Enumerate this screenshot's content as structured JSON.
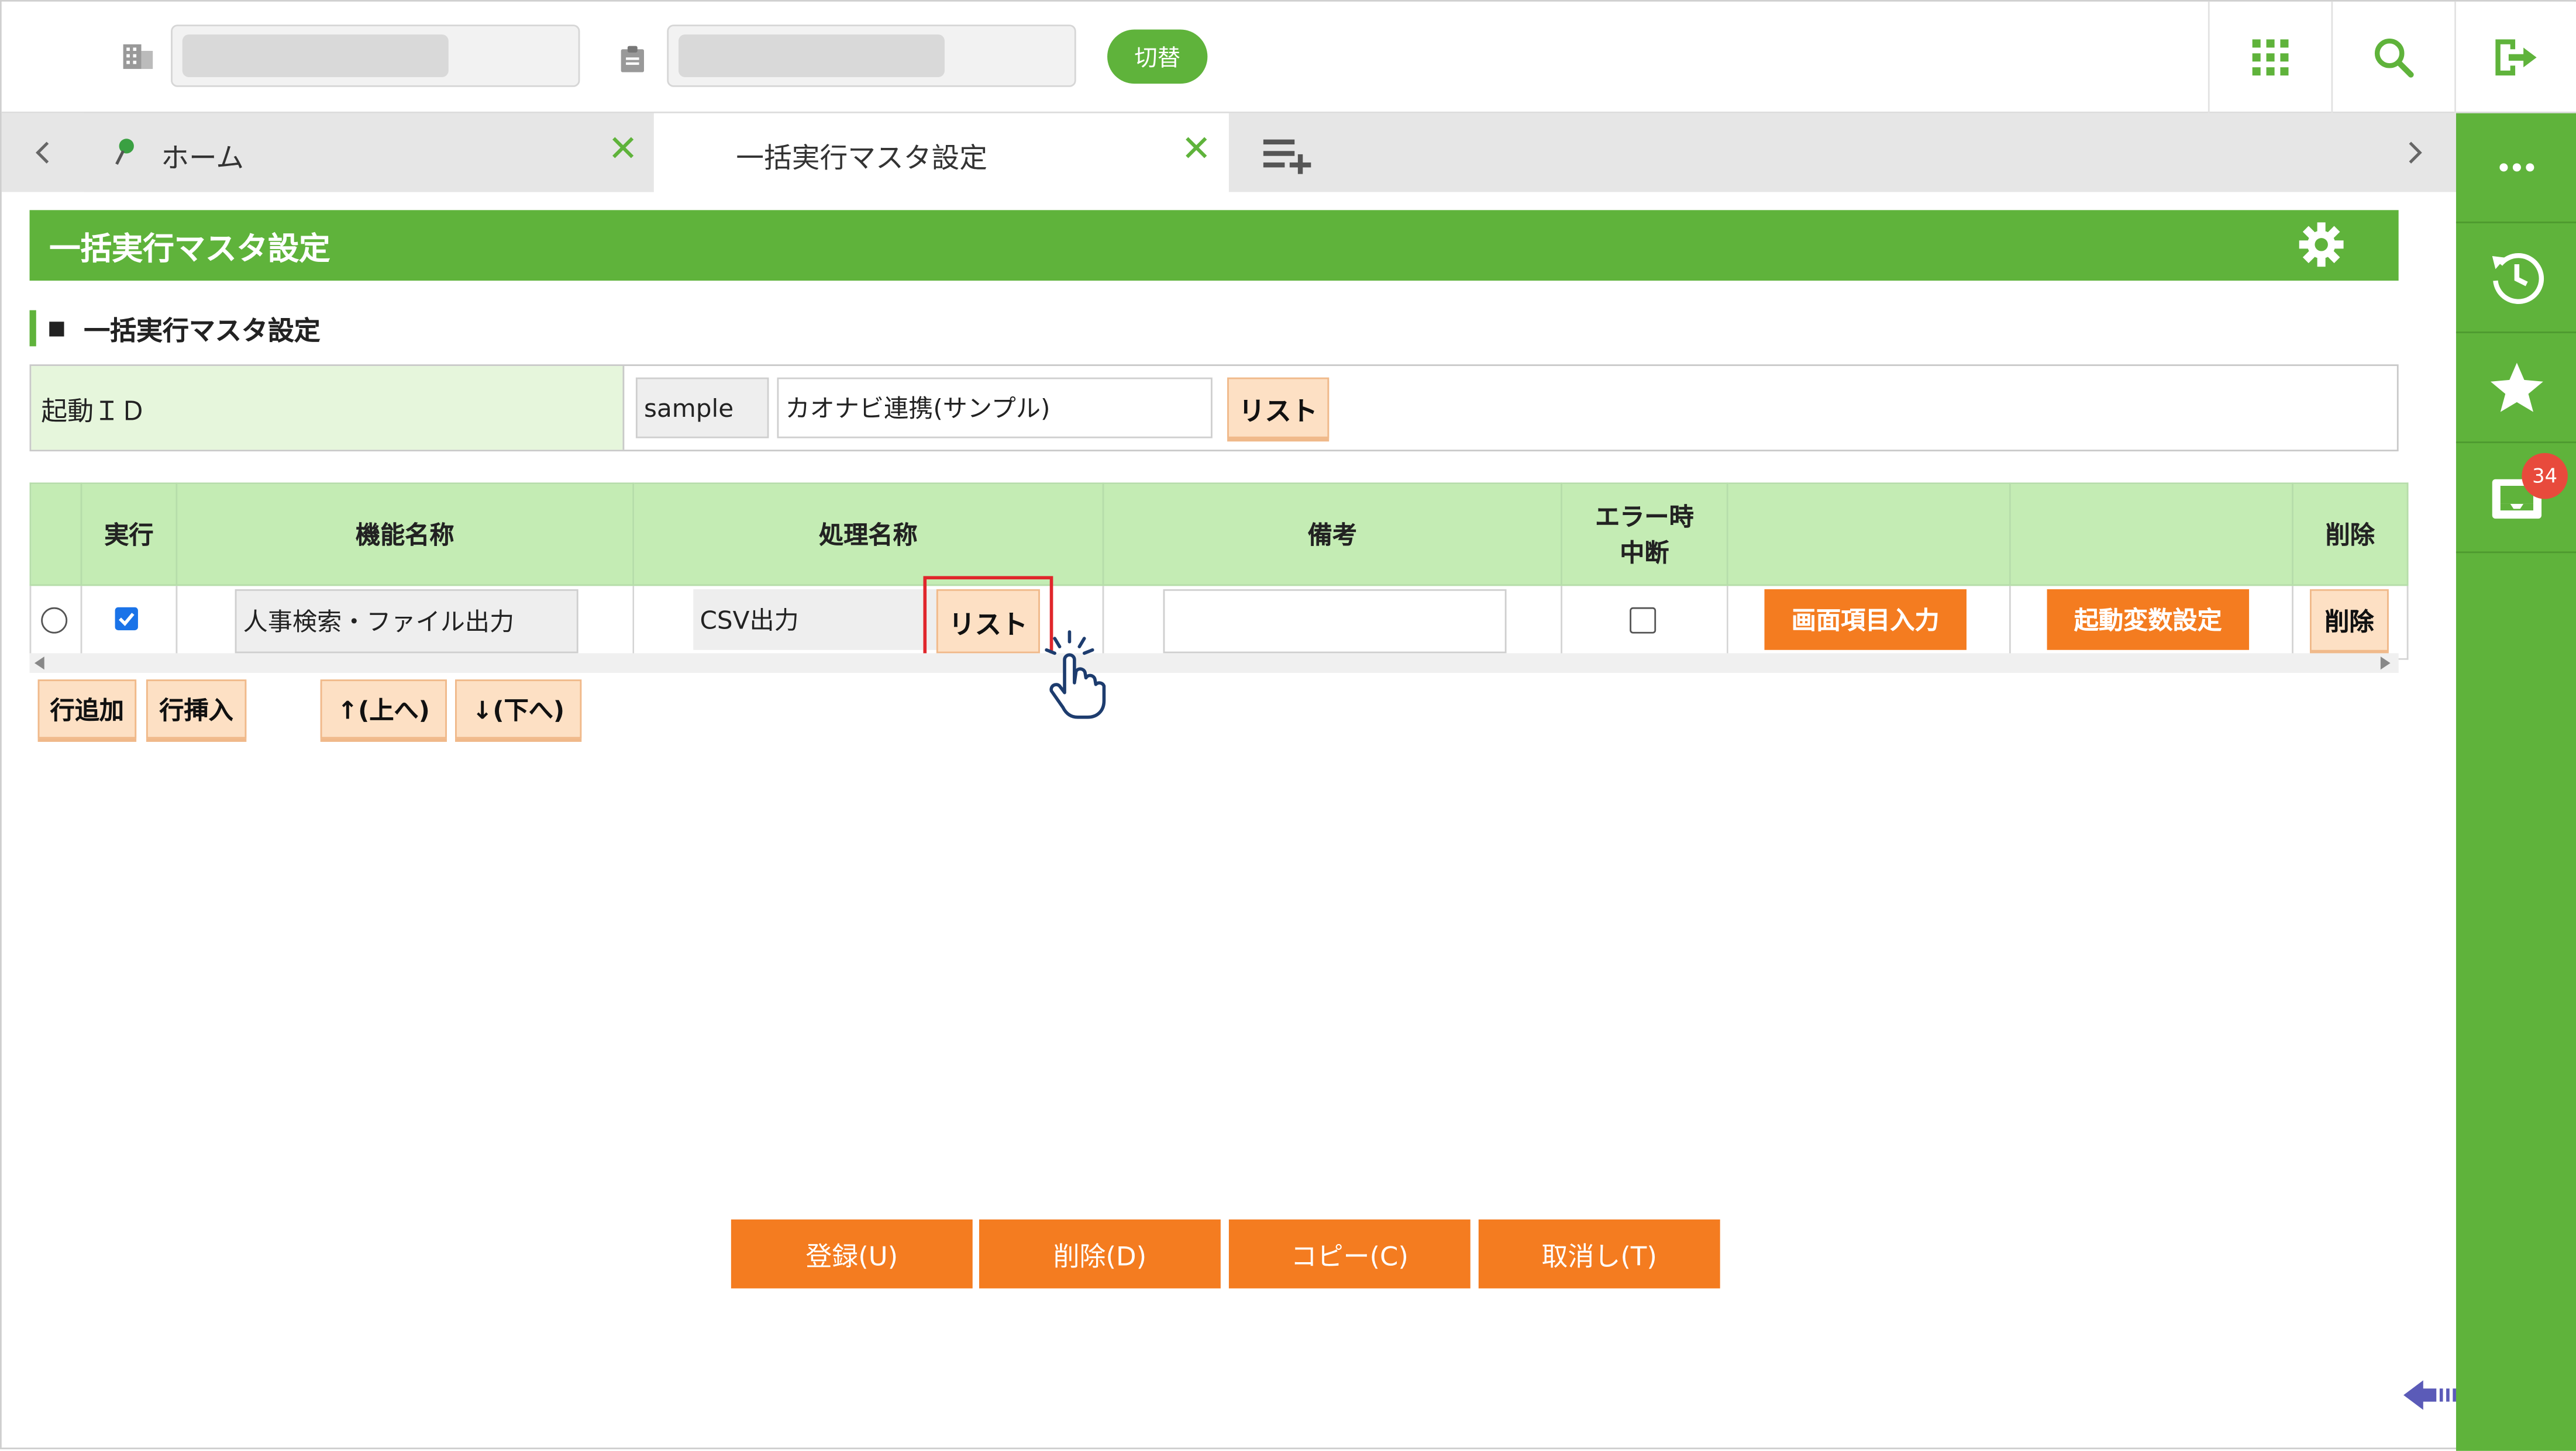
{
  "header": {
    "switch_label": "切替"
  },
  "tabs": {
    "items": [
      {
        "label": "ホーム"
      },
      {
        "label": "一括実行マスタ設定"
      }
    ]
  },
  "sidebar": {
    "notification_count": "34"
  },
  "page": {
    "title": "一括実行マスタ設定",
    "section_title": "一括実行マスタ設定"
  },
  "form": {
    "launch_id_label": "起動ＩＤ",
    "launch_id_value": "sample",
    "launch_name_value": "カオナビ連携(サンプル)",
    "list_button": "リスト"
  },
  "table": {
    "headers": {
      "run": "実行",
      "function_name": "機能名称",
      "process_name": "処理名称",
      "note": "備考",
      "error_stop": "エラー時\n中断",
      "delete": "削除"
    },
    "rows": [
      {
        "function_name": "人事検索・ファイル出力",
        "process_name": "CSV出力",
        "list_button": "リスト",
        "screen_item_button": "画面項目入力",
        "launch_var_button": "起動変数設定",
        "delete_button": "削除"
      }
    ]
  },
  "row_actions": {
    "add_row": "行追加",
    "insert_row": "行挿入",
    "move_up": "↑(上へ)",
    "move_down": "↓(下へ)"
  },
  "footer": {
    "register": "登録(U)",
    "delete": "削除(D)",
    "copy": "コピー(C)",
    "cancel": "取消し(T)"
  },
  "colors": {
    "brand_green": "#5fb33b",
    "header_cell_green": "#c4ecb4",
    "action_orange": "#f47c20",
    "list_button_bg": "#fde0c4",
    "highlight_red": "#e0262b"
  }
}
